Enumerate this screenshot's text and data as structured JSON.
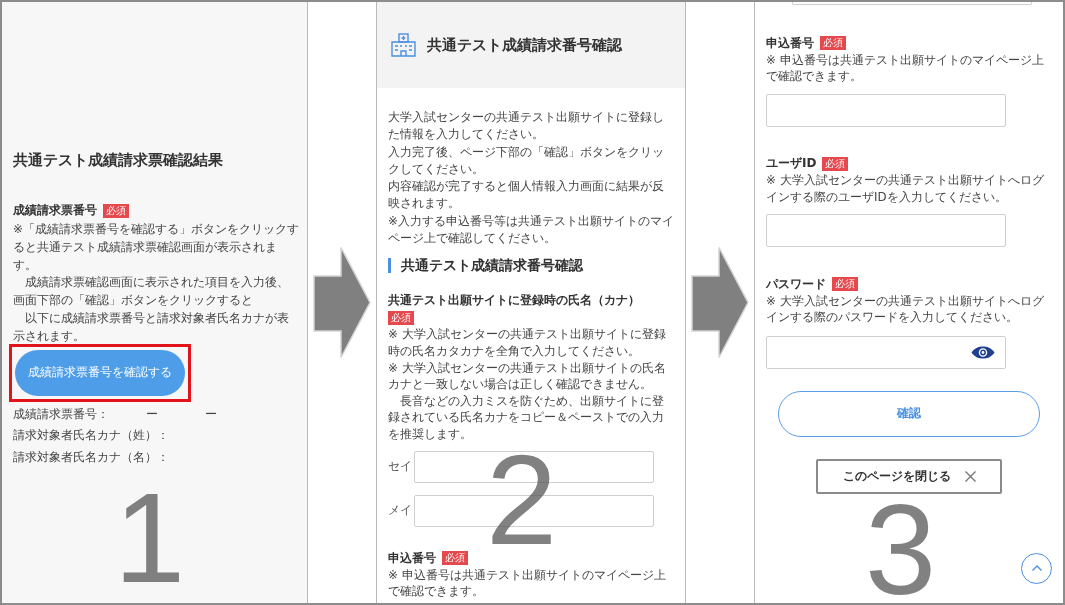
{
  "result_page": {
    "step_number": "1",
    "title": "共通テスト成績請求票確認結果",
    "field": {
      "label": "成績請求票番号",
      "badge": "必須"
    },
    "notes": [
      "※「成績請求票番号を確認する」ボタンをクリックすると共通テスト成績請求票確認画面が表示されます。",
      "　成績請求票確認画面に表示された項目を入力後、画面下部の「確認」ボタンをクリックすると",
      "　以下に成績請求票番号と請求対象者氏名カナが表示されます。"
    ],
    "check_button": {
      "label": "成績請求票番号を確認する",
      "highlighted": true
    },
    "result_rows": [
      {
        "label": "成績請求票番号：",
        "values": [
          "ー",
          "ー"
        ]
      },
      {
        "label": "請求対象者氏名カナ（姓）："
      },
      {
        "label": "請求対象者氏名カナ（名）："
      }
    ]
  },
  "lookup_page_top": {
    "step_number": "2",
    "header_title": "共通テスト成績請求番号確認",
    "intro": [
      "大学入試センターの共通テスト出願サイトに登録した情報を入力してください。",
      "入力完了後、ページ下部の「確認」ボタンをクリックしてください。",
      "内容確認が完了すると個人情報入力画面に結果が反映されます。",
      "※入力する申込番号等は共通テスト出願サイトのマイページ上で確認してください。"
    ],
    "section_heading": "共通テスト成績請求番号確認",
    "name_field": {
      "label": "共通テスト出願サイトに登録時の氏名（カナ）",
      "badge": "必須",
      "notes": [
        "※ 大学入試センターの共通テスト出願サイトに登録時の氏名カタカナを全角で入力してください。",
        "※ 大学入試センターの共通テスト出願サイトの氏名カナと一致しない場合は正しく確認できません。",
        "　長音などの入力ミスを防ぐため、出願サイトに登録されている氏名カナをコピー＆ペーストでの入力を推奨します。"
      ],
      "inputs": [
        {
          "label": "セイ"
        },
        {
          "label": "メイ"
        }
      ]
    },
    "application_number": {
      "label": "申込番号",
      "badge": "必須",
      "notes": [
        "※ 申込番号は共通テスト出願サイトのマイページ上で確認できます。"
      ]
    }
  },
  "lookup_page_bottom": {
    "step_number": "3",
    "fields": [
      {
        "kind": "text",
        "label": "申込番号",
        "badge": "必須",
        "notes": [
          "※ 申込番号は共通テスト出願サイトのマイページ上で確認できます。"
        ]
      },
      {
        "kind": "text",
        "label": "ユーザID",
        "badge": "必須",
        "notes": [
          "※ 大学入試センターの共通テスト出願サイトへログインする際のユーザIDを入力してください。"
        ]
      },
      {
        "kind": "password",
        "label": "パスワード",
        "badge": "必須",
        "notes": [
          "※ 大学入試センターの共通テスト出願サイトへログインする際のパスワードを入力してください。"
        ]
      }
    ],
    "confirm_button": "確認",
    "close_button": "このページを閉じる"
  }
}
